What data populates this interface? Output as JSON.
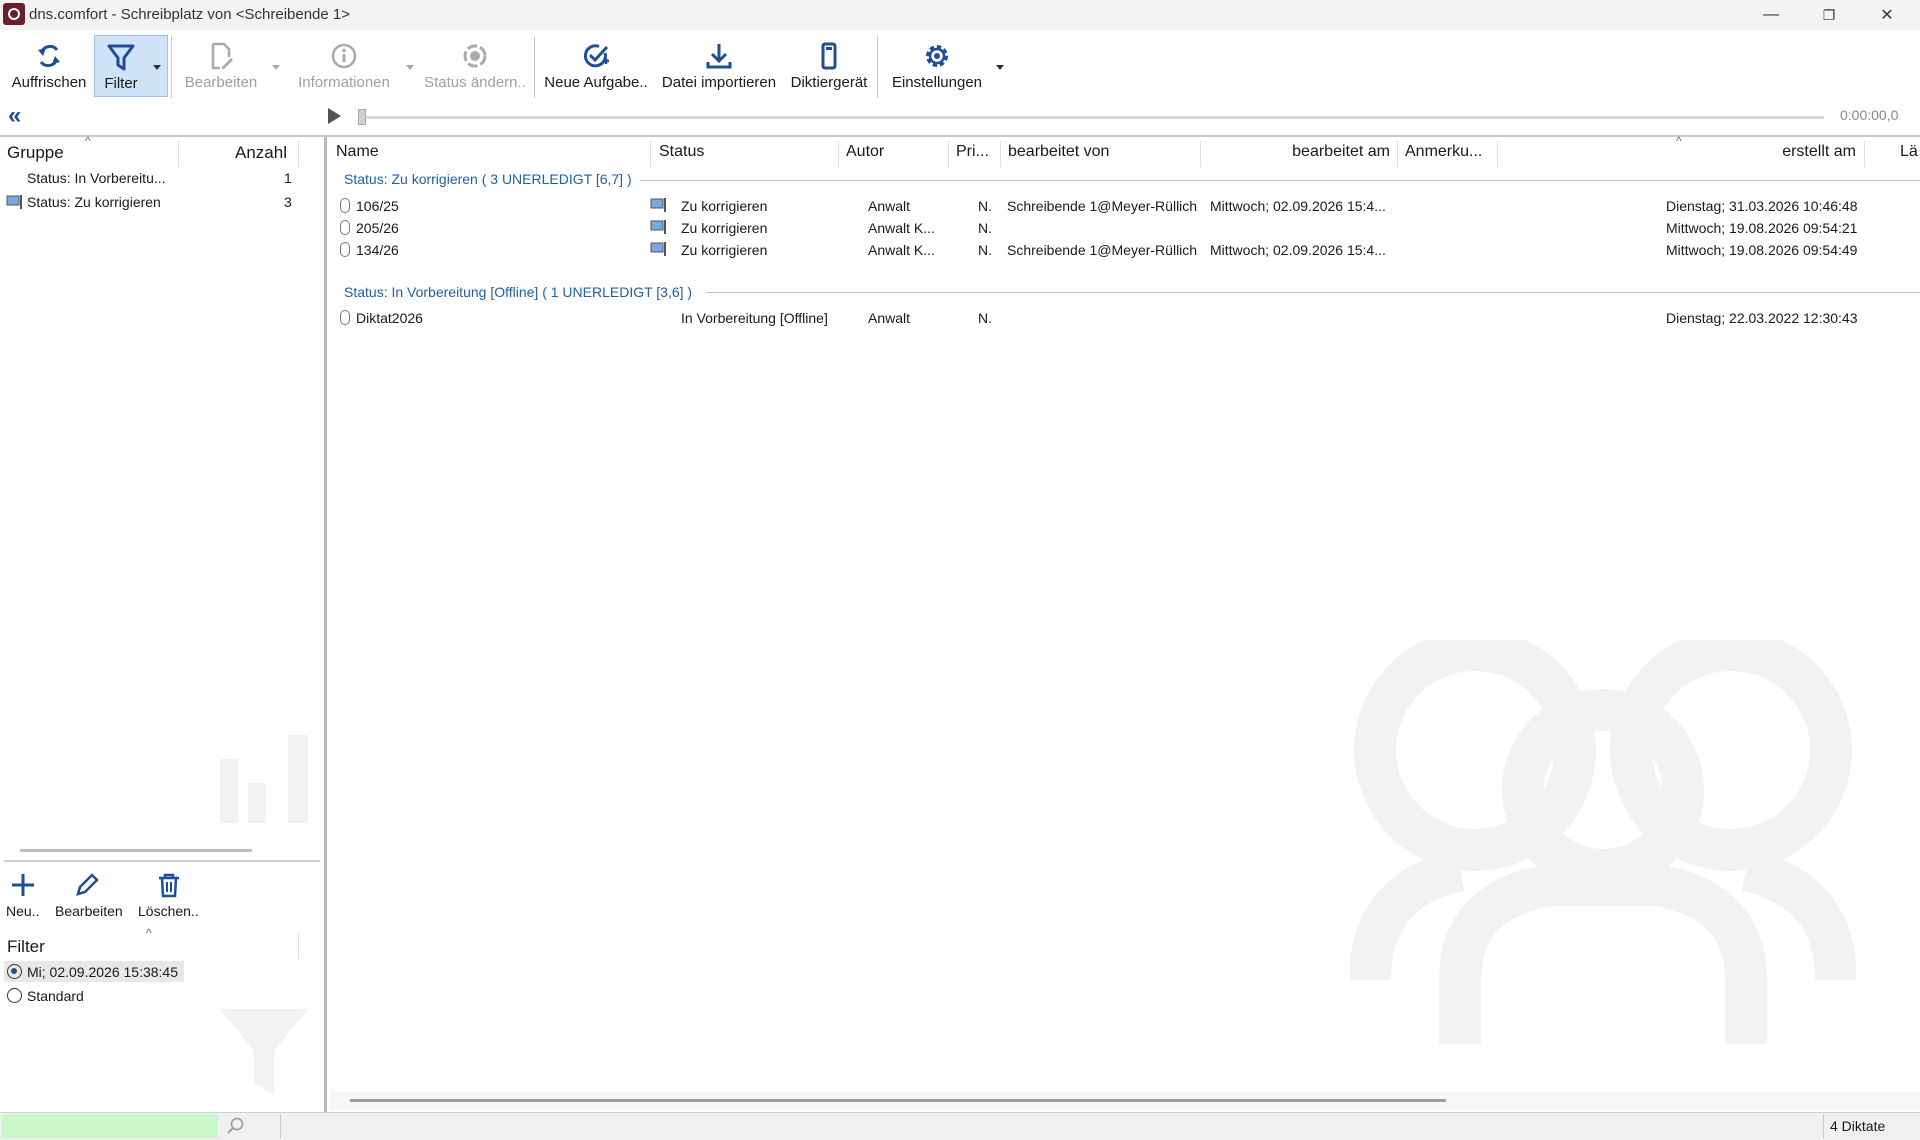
{
  "window": {
    "title": "dns.comfort - Schreibplatz von <Schreibende 1>",
    "minimize": "—",
    "restore": "❐",
    "close": "✕"
  },
  "toolbar": {
    "refresh": "Auffrischen",
    "filter": "Filter",
    "edit": "Bearbeiten",
    "info": "Informationen",
    "status_change": "Status ändern..",
    "new_task": "Neue Aufgabe..",
    "import_file": "Datei importieren",
    "dictation_device": "Diktiergerät",
    "settings": "Einstellungen"
  },
  "player": {
    "collapse": "«",
    "timecode": "0:00:00,0"
  },
  "group_panel": {
    "col_group": "Gruppe",
    "col_count": "Anzahl",
    "items": [
      {
        "label": "Status: In Vorbereitu...",
        "count": "1"
      },
      {
        "label": "Status: Zu korrigieren",
        "count": "3"
      }
    ]
  },
  "filter_panel": {
    "new": "Neu..",
    "edit": "Bearbeiten",
    "delete": "Löschen..",
    "title": "Filter",
    "options": [
      {
        "label": "Mi; 02.09.2026 15:38:45",
        "selected": true
      },
      {
        "label": "Standard",
        "selected": false
      }
    ]
  },
  "grid": {
    "columns": {
      "name": "Name",
      "status": "Status",
      "author": "Autor",
      "priority": "Pri...",
      "edited_by": "bearbeitet von",
      "edited_on": "bearbeitet am",
      "remark": "Anmerku...",
      "created_on": "erstellt am",
      "length": "Lä"
    },
    "groups": [
      {
        "header": "Status: Zu korrigieren ( 3 UNERLEDIGT [6,7] )",
        "rows": [
          {
            "name": "106/25",
            "status": "Zu korrigieren",
            "author": "Anwalt",
            "priority": "N.",
            "edited_by": "Schreibende 1@Meyer-Rüllich",
            "edited_on": "Mittwoch; 02.09.2026 15:4...",
            "created_on": "Dienstag; 31.03.2026 10:46:48"
          },
          {
            "name": "205/26",
            "status": "Zu korrigieren",
            "author": "Anwalt K...",
            "priority": "N.",
            "edited_by": "",
            "edited_on": "",
            "created_on": "Mittwoch; 19.08.2026 09:54:21"
          },
          {
            "name": "134/26",
            "status": "Zu korrigieren",
            "author": "Anwalt K...",
            "priority": "N.",
            "edited_by": "Schreibende 1@Meyer-Rüllich",
            "edited_on": "Mittwoch; 02.09.2026 15:4...",
            "created_on": "Mittwoch; 19.08.2026 09:54:49"
          }
        ]
      },
      {
        "header": "Status: In Vorbereitung [Offline] ( 1 UNERLEDIGT [3,6] )",
        "rows": [
          {
            "name": "Diktat2026",
            "status": "In Vorbereitung [Offline]",
            "author": "Anwalt",
            "priority": "N.",
            "edited_by": "",
            "edited_on": "",
            "created_on": "Dienstag; 22.03.2022 12:30:43"
          }
        ]
      }
    ]
  },
  "statusbar": {
    "count": "4 Diktate"
  },
  "colors": {
    "accent": "#1f4e96",
    "group_header": "#1f5fa8",
    "filter_active_bg": "#cfe4f8",
    "search_bg": "#c9f7c9"
  }
}
